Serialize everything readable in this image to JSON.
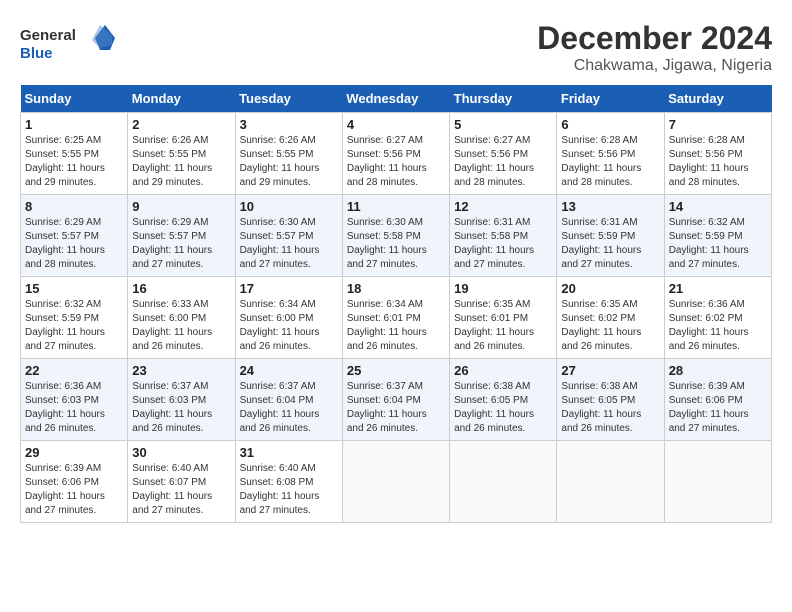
{
  "logo": {
    "line1": "General",
    "line2": "Blue"
  },
  "title": "December 2024",
  "subtitle": "Chakwama, Jigawa, Nigeria",
  "weekdays": [
    "Sunday",
    "Monday",
    "Tuesday",
    "Wednesday",
    "Thursday",
    "Friday",
    "Saturday"
  ],
  "weeks": [
    [
      {
        "day": "1",
        "info": "Sunrise: 6:25 AM\nSunset: 5:55 PM\nDaylight: 11 hours\nand 29 minutes."
      },
      {
        "day": "2",
        "info": "Sunrise: 6:26 AM\nSunset: 5:55 PM\nDaylight: 11 hours\nand 29 minutes."
      },
      {
        "day": "3",
        "info": "Sunrise: 6:26 AM\nSunset: 5:55 PM\nDaylight: 11 hours\nand 29 minutes."
      },
      {
        "day": "4",
        "info": "Sunrise: 6:27 AM\nSunset: 5:56 PM\nDaylight: 11 hours\nand 28 minutes."
      },
      {
        "day": "5",
        "info": "Sunrise: 6:27 AM\nSunset: 5:56 PM\nDaylight: 11 hours\nand 28 minutes."
      },
      {
        "day": "6",
        "info": "Sunrise: 6:28 AM\nSunset: 5:56 PM\nDaylight: 11 hours\nand 28 minutes."
      },
      {
        "day": "7",
        "info": "Sunrise: 6:28 AM\nSunset: 5:56 PM\nDaylight: 11 hours\nand 28 minutes."
      }
    ],
    [
      {
        "day": "8",
        "info": "Sunrise: 6:29 AM\nSunset: 5:57 PM\nDaylight: 11 hours\nand 28 minutes."
      },
      {
        "day": "9",
        "info": "Sunrise: 6:29 AM\nSunset: 5:57 PM\nDaylight: 11 hours\nand 27 minutes."
      },
      {
        "day": "10",
        "info": "Sunrise: 6:30 AM\nSunset: 5:57 PM\nDaylight: 11 hours\nand 27 minutes."
      },
      {
        "day": "11",
        "info": "Sunrise: 6:30 AM\nSunset: 5:58 PM\nDaylight: 11 hours\nand 27 minutes."
      },
      {
        "day": "12",
        "info": "Sunrise: 6:31 AM\nSunset: 5:58 PM\nDaylight: 11 hours\nand 27 minutes."
      },
      {
        "day": "13",
        "info": "Sunrise: 6:31 AM\nSunset: 5:59 PM\nDaylight: 11 hours\nand 27 minutes."
      },
      {
        "day": "14",
        "info": "Sunrise: 6:32 AM\nSunset: 5:59 PM\nDaylight: 11 hours\nand 27 minutes."
      }
    ],
    [
      {
        "day": "15",
        "info": "Sunrise: 6:32 AM\nSunset: 5:59 PM\nDaylight: 11 hours\nand 27 minutes."
      },
      {
        "day": "16",
        "info": "Sunrise: 6:33 AM\nSunset: 6:00 PM\nDaylight: 11 hours\nand 26 minutes."
      },
      {
        "day": "17",
        "info": "Sunrise: 6:34 AM\nSunset: 6:00 PM\nDaylight: 11 hours\nand 26 minutes."
      },
      {
        "day": "18",
        "info": "Sunrise: 6:34 AM\nSunset: 6:01 PM\nDaylight: 11 hours\nand 26 minutes."
      },
      {
        "day": "19",
        "info": "Sunrise: 6:35 AM\nSunset: 6:01 PM\nDaylight: 11 hours\nand 26 minutes."
      },
      {
        "day": "20",
        "info": "Sunrise: 6:35 AM\nSunset: 6:02 PM\nDaylight: 11 hours\nand 26 minutes."
      },
      {
        "day": "21",
        "info": "Sunrise: 6:36 AM\nSunset: 6:02 PM\nDaylight: 11 hours\nand 26 minutes."
      }
    ],
    [
      {
        "day": "22",
        "info": "Sunrise: 6:36 AM\nSunset: 6:03 PM\nDaylight: 11 hours\nand 26 minutes."
      },
      {
        "day": "23",
        "info": "Sunrise: 6:37 AM\nSunset: 6:03 PM\nDaylight: 11 hours\nand 26 minutes."
      },
      {
        "day": "24",
        "info": "Sunrise: 6:37 AM\nSunset: 6:04 PM\nDaylight: 11 hours\nand 26 minutes."
      },
      {
        "day": "25",
        "info": "Sunrise: 6:37 AM\nSunset: 6:04 PM\nDaylight: 11 hours\nand 26 minutes."
      },
      {
        "day": "26",
        "info": "Sunrise: 6:38 AM\nSunset: 6:05 PM\nDaylight: 11 hours\nand 26 minutes."
      },
      {
        "day": "27",
        "info": "Sunrise: 6:38 AM\nSunset: 6:05 PM\nDaylight: 11 hours\nand 26 minutes."
      },
      {
        "day": "28",
        "info": "Sunrise: 6:39 AM\nSunset: 6:06 PM\nDaylight: 11 hours\nand 27 minutes."
      }
    ],
    [
      {
        "day": "29",
        "info": "Sunrise: 6:39 AM\nSunset: 6:06 PM\nDaylight: 11 hours\nand 27 minutes."
      },
      {
        "day": "30",
        "info": "Sunrise: 6:40 AM\nSunset: 6:07 PM\nDaylight: 11 hours\nand 27 minutes."
      },
      {
        "day": "31",
        "info": "Sunrise: 6:40 AM\nSunset: 6:08 PM\nDaylight: 11 hours\nand 27 minutes."
      },
      {
        "day": "",
        "info": ""
      },
      {
        "day": "",
        "info": ""
      },
      {
        "day": "",
        "info": ""
      },
      {
        "day": "",
        "info": ""
      }
    ]
  ]
}
